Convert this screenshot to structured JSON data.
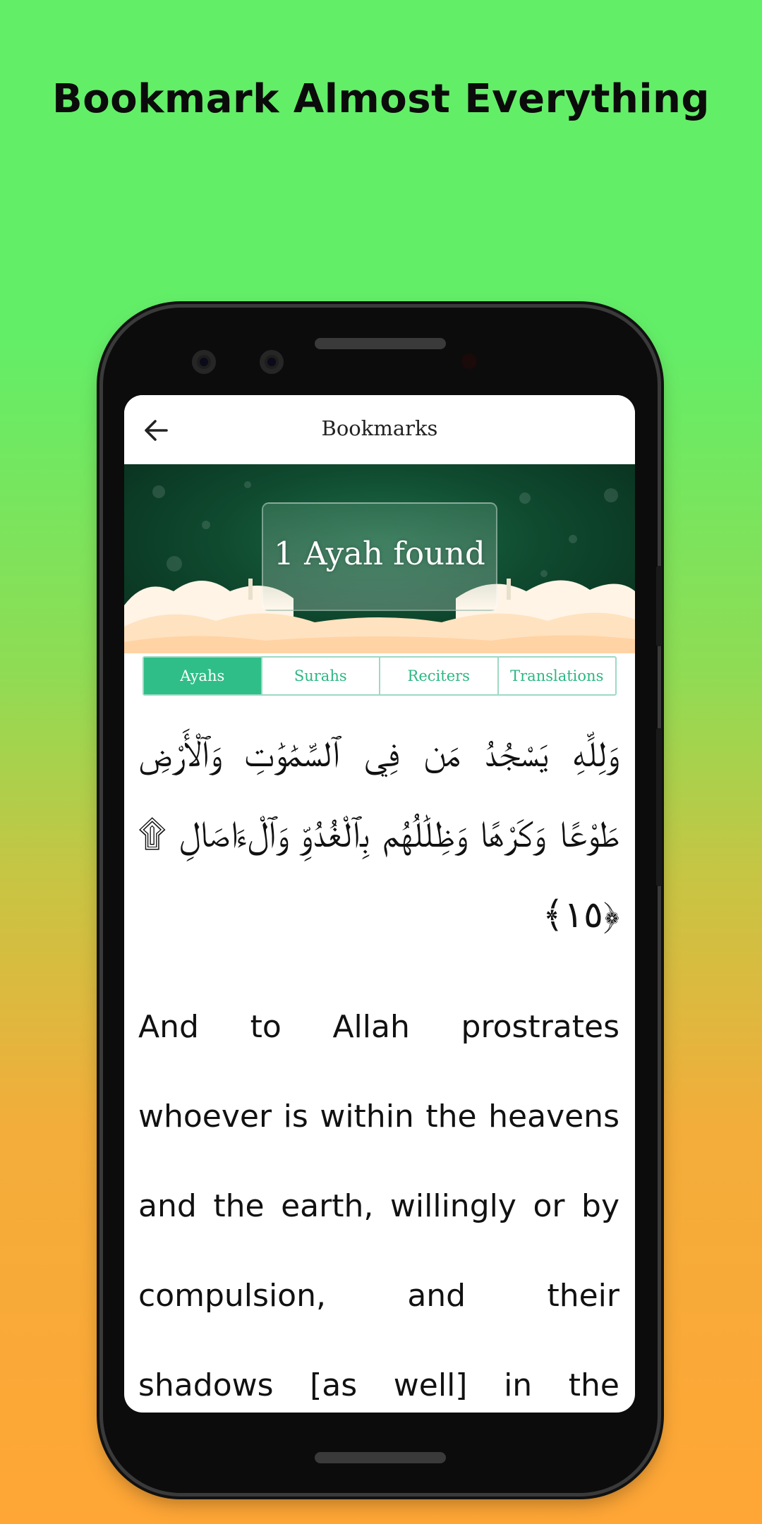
{
  "headline": "Bookmark Almost Everything",
  "appbar": {
    "title": "Bookmarks",
    "back_icon": "arrow-left-icon"
  },
  "banner": {
    "found_text": "1 Ayah found"
  },
  "tabs": [
    {
      "label": "Ayahs",
      "active": true
    },
    {
      "label": "Surahs",
      "active": false
    },
    {
      "label": "Reciters",
      "active": false
    },
    {
      "label": "Translations",
      "active": false
    }
  ],
  "ayah": {
    "arabic": "وَلِلَّهِ يَسْجُدُ مَن فِي ٱلسَّمَٰوَٰتِ وَٱلْأَرْضِ طَوْعًا وَكَرْهًا وَظِلَٰلُهُم بِٱلْغُدُوِّ وَٱلْءَاصَالِ ۩ ﴿١٥﴾",
    "translation": "And to Allah prostrates whoever is within the heavens and the earth, willingly or by compulsion, and their shadows [as well] in the"
  },
  "colors": {
    "bg_top": "#63ee68",
    "bg_bottom": "#ffa636",
    "accent": "#2fbe88",
    "banner_green": "#0f4a2f"
  }
}
